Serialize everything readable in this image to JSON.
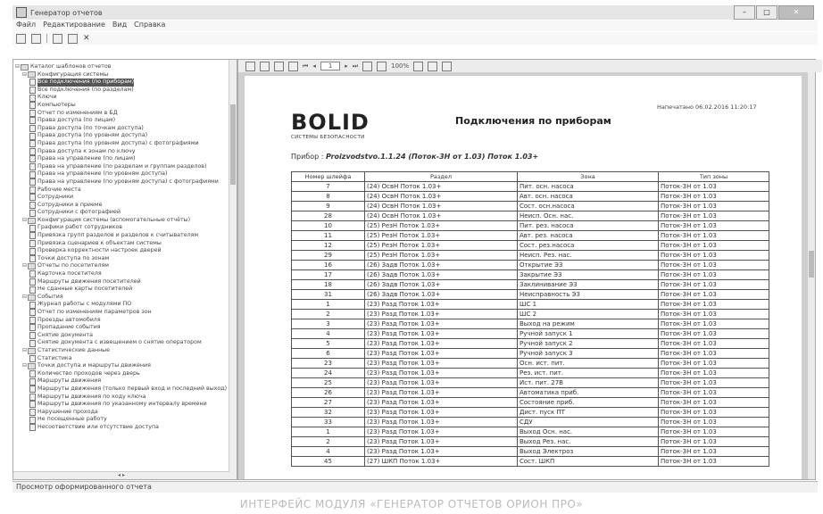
{
  "window": {
    "title": "Генератор отчетов"
  },
  "menu": [
    "Файл",
    "Редактирование",
    "Вид",
    "Справка"
  ],
  "tree": [
    {
      "label": "Каталог шаблонов отчетов",
      "level": 0,
      "type": "folder",
      "toggle": "⊟"
    },
    {
      "label": "Конфигурация системы",
      "level": 1,
      "type": "folder",
      "toggle": "⊟"
    },
    {
      "label": "Все подключения (по приборам)",
      "level": 2,
      "type": "item",
      "selected": true
    },
    {
      "label": "Все подключения (по разделам)",
      "level": 2,
      "type": "item"
    },
    {
      "label": "Ключи",
      "level": 2,
      "type": "item"
    },
    {
      "label": "Компьютеры",
      "level": 2,
      "type": "item"
    },
    {
      "label": "Отчет по изменениям в БД",
      "level": 2,
      "type": "item"
    },
    {
      "label": "Права доступа (по лицам)",
      "level": 2,
      "type": "item"
    },
    {
      "label": "Права доступа (по точкам доступа)",
      "level": 2,
      "type": "item"
    },
    {
      "label": "Права доступа (по уровням доступа)",
      "level": 2,
      "type": "item"
    },
    {
      "label": "Права доступа (по уровням доступа) с фотографиями",
      "level": 2,
      "type": "item"
    },
    {
      "label": "Права доступа к зонам по ключу",
      "level": 2,
      "type": "item"
    },
    {
      "label": "Права на управление (по лицам)",
      "level": 2,
      "type": "item"
    },
    {
      "label": "Права на управление (по разделам и группам разделов)",
      "level": 2,
      "type": "item"
    },
    {
      "label": "Права на управление (по уровням доступа)",
      "level": 2,
      "type": "item"
    },
    {
      "label": "Права на управление (по уровням доступа) с фотографиями",
      "level": 2,
      "type": "item"
    },
    {
      "label": "Рабочие места",
      "level": 2,
      "type": "item"
    },
    {
      "label": "Сотрудники",
      "level": 2,
      "type": "item"
    },
    {
      "label": "Сотрудники в приеме",
      "level": 2,
      "type": "item"
    },
    {
      "label": "Сотрудники с фотографией",
      "level": 2,
      "type": "item"
    },
    {
      "label": "Конфигурация системы (вспомогательные отчёты)",
      "level": 1,
      "type": "folder",
      "toggle": "⊟"
    },
    {
      "label": "Графики работ сотрудников",
      "level": 2,
      "type": "item"
    },
    {
      "label": "Привязка групп разделов и разделов к считывателям",
      "level": 2,
      "type": "item"
    },
    {
      "label": "Привязка сценариев к объектам системы",
      "level": 2,
      "type": "item"
    },
    {
      "label": "Проверка корректности настроек дверей",
      "level": 2,
      "type": "item"
    },
    {
      "label": "Точки доступа по зонам",
      "level": 2,
      "type": "item"
    },
    {
      "label": "Отчеты по посетителям",
      "level": 1,
      "type": "folder",
      "toggle": "⊟"
    },
    {
      "label": "Карточка посетителя",
      "level": 2,
      "type": "item"
    },
    {
      "label": "Маршруты движения посетителей",
      "level": 2,
      "type": "item"
    },
    {
      "label": "Не сданные карты посетителей",
      "level": 2,
      "type": "item"
    },
    {
      "label": "События",
      "level": 1,
      "type": "folder",
      "toggle": "⊟"
    },
    {
      "label": "Журнал работы с модулями ПО",
      "level": 2,
      "type": "item"
    },
    {
      "label": "Отчет по изменениям параметров зон",
      "level": 2,
      "type": "item"
    },
    {
      "label": "Проезды автомобиля",
      "level": 2,
      "type": "item"
    },
    {
      "label": "Пропадание события",
      "level": 2,
      "type": "item"
    },
    {
      "label": "Снятие документа",
      "level": 2,
      "type": "item"
    },
    {
      "label": "Снятие документа с извещением о снятие оператором",
      "level": 2,
      "type": "item"
    },
    {
      "label": "Статистические данные",
      "level": 1,
      "type": "folder",
      "toggle": "⊟"
    },
    {
      "label": "Статистика",
      "level": 2,
      "type": "item"
    },
    {
      "label": "Точки доступа и маршруты движения",
      "level": 1,
      "type": "folder",
      "toggle": "⊟"
    },
    {
      "label": "Количество проходов через дверь",
      "level": 2,
      "type": "item"
    },
    {
      "label": "Маршруты движения",
      "level": 2,
      "type": "item"
    },
    {
      "label": "Маршруты движения (только первый вход и последний выход)",
      "level": 2,
      "type": "item"
    },
    {
      "label": "Маршруты движения по коду ключа",
      "level": 2,
      "type": "item"
    },
    {
      "label": "Маршруты движения по указанному интервалу времени",
      "level": 2,
      "type": "item"
    },
    {
      "label": "Нарушение прохода",
      "level": 2,
      "type": "item"
    },
    {
      "label": "Не посещенные работу",
      "level": 2,
      "type": "item"
    },
    {
      "label": "Несоответствие или отсутствие доступа",
      "level": 2,
      "type": "item"
    }
  ],
  "viewer": {
    "page_field": "1",
    "zoom": "100%"
  },
  "report": {
    "logo_text": "BOLID",
    "logo_sub": "СИСТЕМЫ БЕЗОПАСНОСТИ",
    "title": "Подключения по приборам",
    "printed": "Напечатано 06.02.2016 11:20:17",
    "device_label": "Прибор :",
    "device_value": "Proizvodstvo.1.1.24 (Поток-3Н от 1.03) Поток 1.03+",
    "columns": [
      "Номер шлейфа",
      "Раздел",
      "Зона",
      "Тип зоны"
    ],
    "rows": [
      [
        "7",
        "(24) ОсвН Поток 1.03+",
        "Пит. осн. насоса",
        "Поток-3Н от 1.03"
      ],
      [
        "8",
        "(24) ОсвН Поток 1.03+",
        "Авт. осн. насоса",
        "Поток-3Н от 1.03"
      ],
      [
        "9",
        "(24) ОсвН Поток 1.03+",
        "Сост. осн.насоса",
        "Поток-3Н от 1.03"
      ],
      [
        "28",
        "(24) ОсвН Поток 1.03+",
        "Неисп. Осн. нас.",
        "Поток-3Н от 1.03"
      ],
      [
        "10",
        "(25) РезН Поток 1.03+",
        "Пит. рез. насоса",
        "Поток-3Н от 1.03"
      ],
      [
        "11",
        "(25) РезН Поток 1.03+",
        "Авт. рез. насоса",
        "Поток-3Н от 1.03"
      ],
      [
        "12",
        "(25) РезН Поток 1.03+",
        "Сост. рез.насоса",
        "Поток-3Н от 1.03"
      ],
      [
        "29",
        "(25) РезН Поток 1.03+",
        "Неисп. Рез. нас.",
        "Поток-3Н от 1.03"
      ],
      [
        "16",
        "(26) Задв Поток 1.03+",
        "Открытие ЭЗ",
        "Поток-3Н от 1.03"
      ],
      [
        "17",
        "(26) Задв Поток 1.03+",
        "Закрытие ЭЗ",
        "Поток-3Н от 1.03"
      ],
      [
        "18",
        "(26) Задв Поток 1.03+",
        "Заклинивание ЭЗ",
        "Поток-3Н от 1.03"
      ],
      [
        "31",
        "(26) Задв Поток 1.03+",
        "Неисправность ЭЗ",
        "Поток-3Н от 1.03"
      ],
      [
        "1",
        "(23) Разд Поток 1.03+",
        "ШС 1",
        "Поток-3Н от 1.03"
      ],
      [
        "2",
        "(23) Разд Поток 1.03+",
        "ШС 2",
        "Поток-3Н от 1.03"
      ],
      [
        "3",
        "(23) Разд Поток 1.03+",
        "Выход на режим",
        "Поток-3Н от 1.03"
      ],
      [
        "4",
        "(23) Разд Поток 1.03+",
        "Ручной запуск 1",
        "Поток-3Н от 1.03"
      ],
      [
        "5",
        "(23) Разд Поток 1.03+",
        "Ручной запуск 2",
        "Поток-3Н от 1.03"
      ],
      [
        "6",
        "(23) Разд Поток 1.03+",
        "Ручной запуск 3",
        "Поток-3Н от 1.03"
      ],
      [
        "23",
        "(23) Разд Поток 1.03+",
        "Осн. ист. пит.",
        "Поток-3Н от 1.03"
      ],
      [
        "24",
        "(23) Разд Поток 1.03+",
        "Рез. ист. пит.",
        "Поток-3Н от 1.03"
      ],
      [
        "25",
        "(23) Разд Поток 1.03+",
        "Ист. пит. 27В",
        "Поток-3Н от 1.03"
      ],
      [
        "26",
        "(23) Разд Поток 1.03+",
        "Автоматика приб.",
        "Поток-3Н от 1.03"
      ],
      [
        "27",
        "(23) Разд Поток 1.03+",
        "Состояние приб.",
        "Поток-3Н от 1.03"
      ],
      [
        "32",
        "(23) Разд Поток 1.03+",
        "Дист. пуск ПТ",
        "Поток-3Н от 1.03"
      ],
      [
        "33",
        "(23) Разд Поток 1.03+",
        "СДУ",
        "Поток-3Н от 1.03"
      ],
      [
        "1",
        "(23) Разд Поток 1.03+",
        "Выход Осн. нас.",
        "Поток-3Н от 1.03"
      ],
      [
        "2",
        "(23) Разд Поток 1.03+",
        "Выход Рез. нас.",
        "Поток-3Н от 1.03"
      ],
      [
        "4",
        "(23) Разд Поток 1.03+",
        "Выход Электроз",
        "Поток-3Н от 1.03"
      ],
      [
        "45",
        "(27) ШКП Поток 1.03+",
        "Сост. ШКП",
        "Поток-3Н от 1.03"
      ]
    ]
  },
  "status": "Просмотр оформированного отчета",
  "caption": "ИНТЕРФЕЙС МОДУЛЯ «ГЕНЕРАТОР ОТЧЕТОВ ОРИОН ПРО»"
}
